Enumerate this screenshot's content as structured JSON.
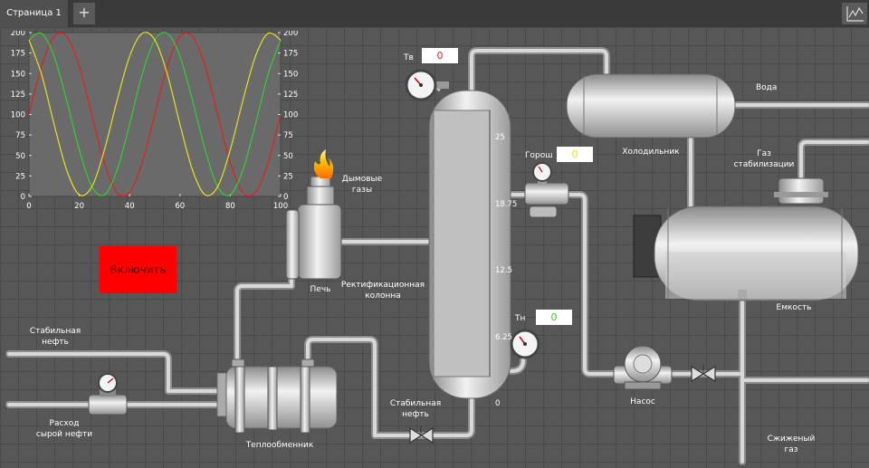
{
  "tabs": {
    "page1_label": "Страница 1",
    "add_label": "+"
  },
  "toolbar": {
    "chart_icon": "line-chart-icon"
  },
  "colors": {
    "background": "#575757",
    "pipe": "#c8c8c8",
    "button_on": "#ff0000",
    "series_red": "#e02020",
    "series_green": "#30d030",
    "series_yellow": "#e8e020"
  },
  "chart_data": {
    "type": "line",
    "x": [
      0,
      5,
      10,
      15,
      20,
      25,
      30,
      35,
      40,
      45,
      50,
      55,
      60,
      65,
      70,
      75,
      80,
      85,
      90,
      95,
      100
    ],
    "xticks": [
      "0",
      "20",
      "40",
      "60",
      "80",
      "100"
    ],
    "yticks": [
      "0",
      "25",
      "50",
      "75",
      "100",
      "125",
      "150",
      "175",
      "200"
    ],
    "xlim": [
      0,
      100
    ],
    "ylim": [
      0,
      200
    ],
    "series": [
      {
        "color": "#e02020",
        "values": [
          100,
          159,
          195,
          195,
          159,
          100,
          41,
          5,
          5,
          41,
          100,
          159,
          195,
          195,
          159,
          100,
          41,
          5,
          5,
          41,
          100
        ]
      },
      {
        "color": "#30d030",
        "values": [
          191,
          199,
          171,
          117,
          57,
          12,
          2,
          32,
          88,
          149,
          191,
          199,
          171,
          117,
          57,
          12,
          2,
          32,
          88,
          149,
          191
        ]
      },
      {
        "color": "#e8e020",
        "values": [
          191,
          149,
          88,
          32,
          2,
          12,
          57,
          117,
          171,
          199,
          191,
          149,
          88,
          32,
          2,
          12,
          57,
          117,
          171,
          199,
          191
        ]
      }
    ],
    "grid": false,
    "legend": "none"
  },
  "labels": {
    "tv": "Тв",
    "tn": "Тн",
    "gorosh": "Горош",
    "furnace": "Печь",
    "flue_gas": "Дымовые\nгазы",
    "column": "Ректификационная\nколонна",
    "cooler": "Холодильник",
    "water": "Вода",
    "stab_gas": "Газ\nстабилизации",
    "tank": "Емкость",
    "pump": "Насос",
    "lpg": "Сжиженый\nгаз",
    "stable_oil_left": "Стабильная\nнефть",
    "stable_oil_bottom": "Стабильная\nнефть",
    "crude_flow": "Расход\nсырой нефти",
    "heat_exchanger": "Теплообменник"
  },
  "values": {
    "tv": "0",
    "gorosh": "0",
    "tn": "0"
  },
  "column_scale": [
    "25",
    "18.75",
    "12.5",
    "6.25",
    "0"
  ],
  "column_level": 0,
  "button_on_label": "Включить"
}
